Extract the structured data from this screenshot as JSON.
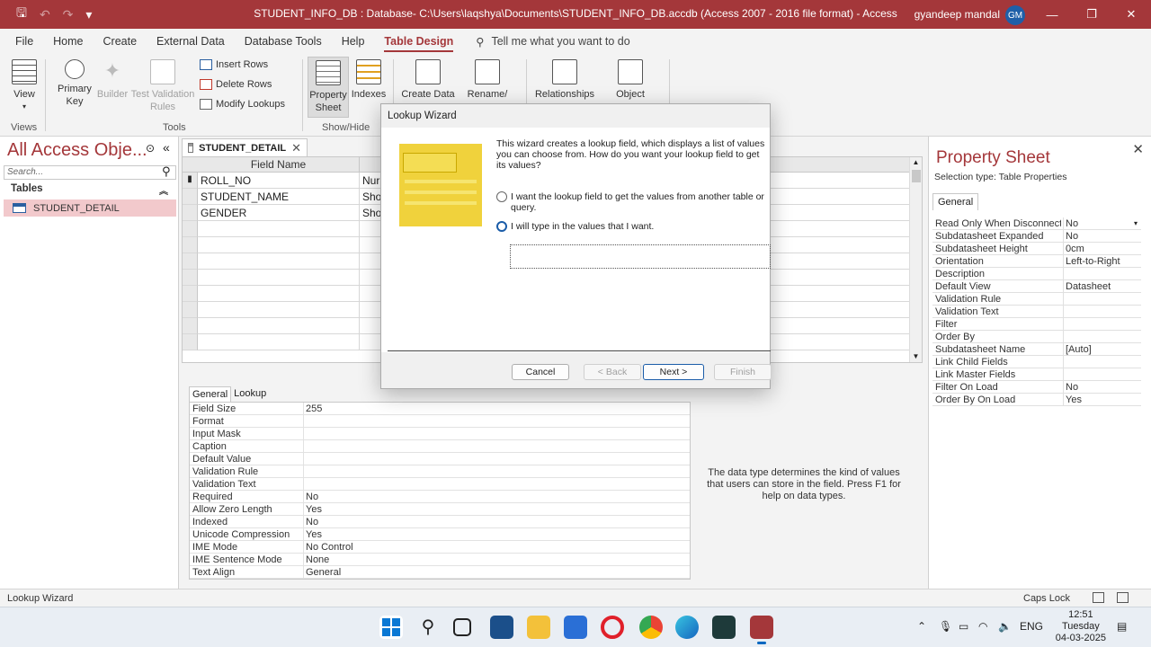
{
  "titlebar": {
    "title": "STUDENT_INFO_DB : Database- C:\\Users\\laqshya\\Documents\\STUDENT_INFO_DB.accdb (Access 2007 - 2016 file format)  -  Access",
    "user": "gyandeep mandal",
    "initials": "GM"
  },
  "menu": {
    "tabs": [
      "File",
      "Home",
      "Create",
      "External Data",
      "Database Tools",
      "Help",
      "Table Design"
    ],
    "tellme": "Tell me what you want to do"
  },
  "ribbon": {
    "view": "View",
    "primary_key": "Primary Key",
    "builder": "Builder",
    "test_validation": "Test Validation Rules",
    "insert_rows": "Insert Rows",
    "delete_rows": "Delete Rows",
    "modify_lookups": "Modify Lookups",
    "property_sheet": "Property Sheet",
    "indexes": "Indexes",
    "create_data": "Create Data",
    "rename": "Rename/",
    "relationships": "Relationships",
    "object": "Object",
    "groups": {
      "views": "Views",
      "tools": "Tools",
      "showhide": "Show/Hide"
    }
  },
  "nav": {
    "title": "All Access Obje...",
    "search_placeholder": "Search...",
    "section": "Tables",
    "item": "STUDENT_DETAIL"
  },
  "document": {
    "tab": "STUDENT_DETAIL",
    "columns": {
      "field_name": "Field Name"
    },
    "rows": [
      {
        "name": "ROLL_NO",
        "type": "Nur"
      },
      {
        "name": "STUDENT_NAME",
        "type": "Sho"
      },
      {
        "name": "GENDER",
        "type": "Sho"
      }
    ]
  },
  "field_props": {
    "tabs": [
      "General",
      "Lookup"
    ],
    "rows": [
      [
        "Field Size",
        "255"
      ],
      [
        "Format",
        ""
      ],
      [
        "Input Mask",
        ""
      ],
      [
        "Caption",
        ""
      ],
      [
        "Default Value",
        ""
      ],
      [
        "Validation Rule",
        ""
      ],
      [
        "Validation Text",
        ""
      ],
      [
        "Required",
        "No"
      ],
      [
        "Allow Zero Length",
        "Yes"
      ],
      [
        "Indexed",
        "No"
      ],
      [
        "Unicode Compression",
        "Yes"
      ],
      [
        "IME Mode",
        "No Control"
      ],
      [
        "IME Sentence Mode",
        "None"
      ],
      [
        "Text Align",
        "General"
      ]
    ],
    "help": "The data type determines the kind of values that users can store in the field. Press F1 for help on data types."
  },
  "property_sheet": {
    "title": "Property Sheet",
    "selection_type": "Selection type:  Table Properties",
    "tab": "General",
    "rows": [
      [
        "Read Only When Disconnected",
        "No"
      ],
      [
        "Subdatasheet Expanded",
        "No"
      ],
      [
        "Subdatasheet Height",
        "0cm"
      ],
      [
        "Orientation",
        "Left-to-Right"
      ],
      [
        "Description",
        ""
      ],
      [
        "Default View",
        "Datasheet"
      ],
      [
        "Validation Rule",
        ""
      ],
      [
        "Validation Text",
        ""
      ],
      [
        "Filter",
        ""
      ],
      [
        "Order By",
        ""
      ],
      [
        "Subdatasheet Name",
        "[Auto]"
      ],
      [
        "Link Child Fields",
        ""
      ],
      [
        "Link Master Fields",
        ""
      ],
      [
        "Filter On Load",
        "No"
      ],
      [
        "Order By On Load",
        "Yes"
      ]
    ]
  },
  "dialog": {
    "title": "Lookup Wizard",
    "description": "This wizard creates a lookup field, which displays a list of values you can choose from.  How do you want your lookup field to get its values?",
    "option1": "I want the lookup field to get the values from another table or query.",
    "option2": "I will type in the values that I want.",
    "buttons": {
      "cancel": "Cancel",
      "back": "< Back",
      "next": "Next >",
      "finish": "Finish"
    }
  },
  "status": {
    "left": "Lookup Wizard",
    "caps": "Caps Lock"
  },
  "taskbar": {
    "lang": "ENG",
    "time": "12:51",
    "day": "Tuesday",
    "date": "04-03-2025"
  }
}
